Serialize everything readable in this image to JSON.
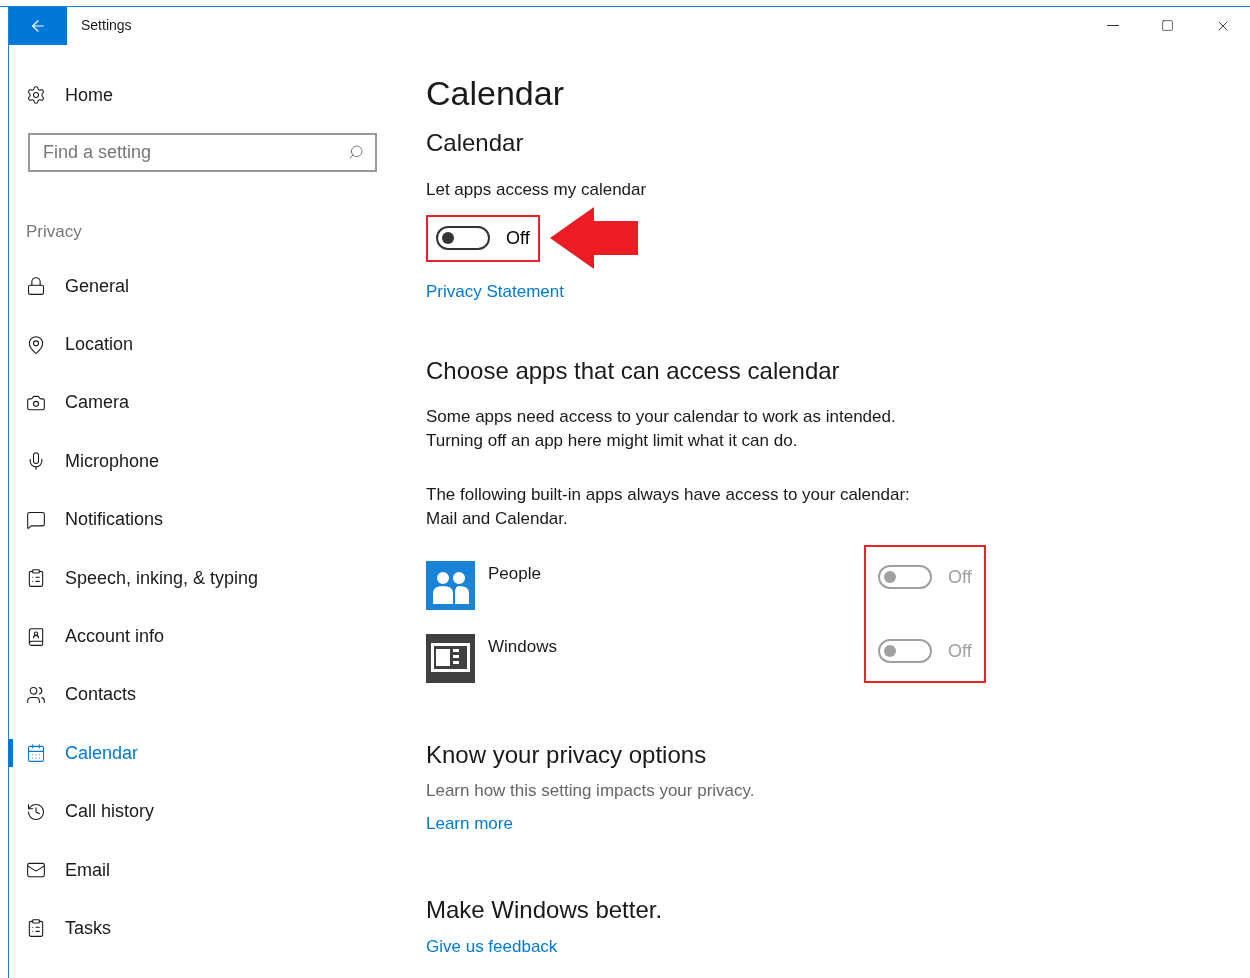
{
  "window": {
    "title": "Settings"
  },
  "sidebar": {
    "home": "Home",
    "search": {
      "placeholder": "Find a setting"
    },
    "section": "Privacy",
    "items": [
      {
        "label": "General",
        "selected": false
      },
      {
        "label": "Location",
        "selected": false
      },
      {
        "label": "Camera",
        "selected": false
      },
      {
        "label": "Microphone",
        "selected": false
      },
      {
        "label": "Notifications",
        "selected": false
      },
      {
        "label": "Speech, inking, & typing",
        "selected": false
      },
      {
        "label": "Account info",
        "selected": false
      },
      {
        "label": "Contacts",
        "selected": false
      },
      {
        "label": "Calendar",
        "selected": true
      },
      {
        "label": "Call history",
        "selected": false
      },
      {
        "label": "Email",
        "selected": false
      },
      {
        "label": "Tasks",
        "selected": false
      }
    ]
  },
  "content": {
    "page_title": "Calendar",
    "heading": "Calendar",
    "toggle_label": "Let apps access my calendar",
    "master_toggle": {
      "on": false,
      "label": "Off",
      "highlighted": true
    },
    "privacy_link": "Privacy Statement",
    "choose_heading": "Choose apps that can access calendar",
    "choose_text": [
      "Some apps need access to your calendar to work as intended.",
      "Turning off an app here might limit what it can do."
    ],
    "builtin_text": [
      "The following built-in apps always have access to your calendar:",
      "Mail and Calendar."
    ],
    "apps_highlighted": true,
    "apps": [
      {
        "name": "People",
        "kind": "people",
        "toggle": {
          "on": false,
          "label": "Off",
          "disabled": true
        }
      },
      {
        "name": "Windows",
        "kind": "windows",
        "toggle": {
          "on": false,
          "label": "Off",
          "disabled": true
        }
      }
    ],
    "know_heading": "Know your privacy options",
    "know_text": "Learn how this setting impacts your privacy.",
    "learn_more": "Learn more",
    "better_heading": "Make Windows better.",
    "feedback": "Give us feedback"
  }
}
